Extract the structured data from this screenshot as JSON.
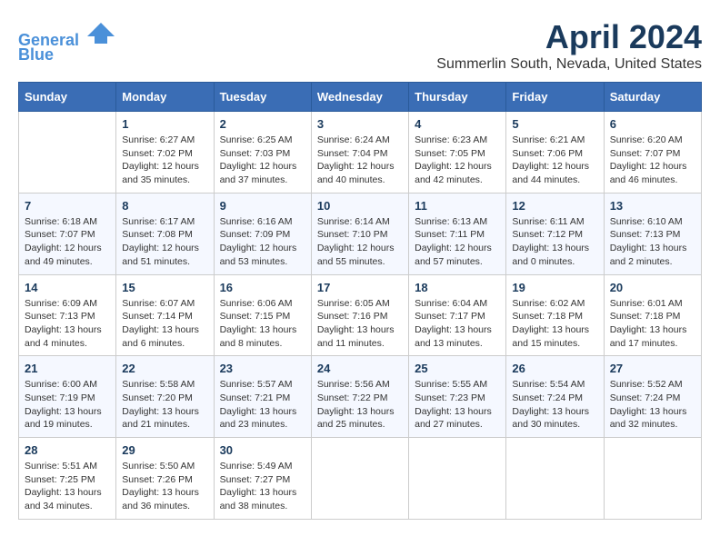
{
  "header": {
    "logo_line1": "General",
    "logo_line2": "Blue",
    "month_title": "April 2024",
    "location": "Summerlin South, Nevada, United States"
  },
  "weekdays": [
    "Sunday",
    "Monday",
    "Tuesday",
    "Wednesday",
    "Thursday",
    "Friday",
    "Saturday"
  ],
  "weeks": [
    [
      {
        "day": "",
        "info": ""
      },
      {
        "day": "1",
        "info": "Sunrise: 6:27 AM\nSunset: 7:02 PM\nDaylight: 12 hours\nand 35 minutes."
      },
      {
        "day": "2",
        "info": "Sunrise: 6:25 AM\nSunset: 7:03 PM\nDaylight: 12 hours\nand 37 minutes."
      },
      {
        "day": "3",
        "info": "Sunrise: 6:24 AM\nSunset: 7:04 PM\nDaylight: 12 hours\nand 40 minutes."
      },
      {
        "day": "4",
        "info": "Sunrise: 6:23 AM\nSunset: 7:05 PM\nDaylight: 12 hours\nand 42 minutes."
      },
      {
        "day": "5",
        "info": "Sunrise: 6:21 AM\nSunset: 7:06 PM\nDaylight: 12 hours\nand 44 minutes."
      },
      {
        "day": "6",
        "info": "Sunrise: 6:20 AM\nSunset: 7:07 PM\nDaylight: 12 hours\nand 46 minutes."
      }
    ],
    [
      {
        "day": "7",
        "info": "Sunrise: 6:18 AM\nSunset: 7:07 PM\nDaylight: 12 hours\nand 49 minutes."
      },
      {
        "day": "8",
        "info": "Sunrise: 6:17 AM\nSunset: 7:08 PM\nDaylight: 12 hours\nand 51 minutes."
      },
      {
        "day": "9",
        "info": "Sunrise: 6:16 AM\nSunset: 7:09 PM\nDaylight: 12 hours\nand 53 minutes."
      },
      {
        "day": "10",
        "info": "Sunrise: 6:14 AM\nSunset: 7:10 PM\nDaylight: 12 hours\nand 55 minutes."
      },
      {
        "day": "11",
        "info": "Sunrise: 6:13 AM\nSunset: 7:11 PM\nDaylight: 12 hours\nand 57 minutes."
      },
      {
        "day": "12",
        "info": "Sunrise: 6:11 AM\nSunset: 7:12 PM\nDaylight: 13 hours\nand 0 minutes."
      },
      {
        "day": "13",
        "info": "Sunrise: 6:10 AM\nSunset: 7:13 PM\nDaylight: 13 hours\nand 2 minutes."
      }
    ],
    [
      {
        "day": "14",
        "info": "Sunrise: 6:09 AM\nSunset: 7:13 PM\nDaylight: 13 hours\nand 4 minutes."
      },
      {
        "day": "15",
        "info": "Sunrise: 6:07 AM\nSunset: 7:14 PM\nDaylight: 13 hours\nand 6 minutes."
      },
      {
        "day": "16",
        "info": "Sunrise: 6:06 AM\nSunset: 7:15 PM\nDaylight: 13 hours\nand 8 minutes."
      },
      {
        "day": "17",
        "info": "Sunrise: 6:05 AM\nSunset: 7:16 PM\nDaylight: 13 hours\nand 11 minutes."
      },
      {
        "day": "18",
        "info": "Sunrise: 6:04 AM\nSunset: 7:17 PM\nDaylight: 13 hours\nand 13 minutes."
      },
      {
        "day": "19",
        "info": "Sunrise: 6:02 AM\nSunset: 7:18 PM\nDaylight: 13 hours\nand 15 minutes."
      },
      {
        "day": "20",
        "info": "Sunrise: 6:01 AM\nSunset: 7:18 PM\nDaylight: 13 hours\nand 17 minutes."
      }
    ],
    [
      {
        "day": "21",
        "info": "Sunrise: 6:00 AM\nSunset: 7:19 PM\nDaylight: 13 hours\nand 19 minutes."
      },
      {
        "day": "22",
        "info": "Sunrise: 5:58 AM\nSunset: 7:20 PM\nDaylight: 13 hours\nand 21 minutes."
      },
      {
        "day": "23",
        "info": "Sunrise: 5:57 AM\nSunset: 7:21 PM\nDaylight: 13 hours\nand 23 minutes."
      },
      {
        "day": "24",
        "info": "Sunrise: 5:56 AM\nSunset: 7:22 PM\nDaylight: 13 hours\nand 25 minutes."
      },
      {
        "day": "25",
        "info": "Sunrise: 5:55 AM\nSunset: 7:23 PM\nDaylight: 13 hours\nand 27 minutes."
      },
      {
        "day": "26",
        "info": "Sunrise: 5:54 AM\nSunset: 7:24 PM\nDaylight: 13 hours\nand 30 minutes."
      },
      {
        "day": "27",
        "info": "Sunrise: 5:52 AM\nSunset: 7:24 PM\nDaylight: 13 hours\nand 32 minutes."
      }
    ],
    [
      {
        "day": "28",
        "info": "Sunrise: 5:51 AM\nSunset: 7:25 PM\nDaylight: 13 hours\nand 34 minutes."
      },
      {
        "day": "29",
        "info": "Sunrise: 5:50 AM\nSunset: 7:26 PM\nDaylight: 13 hours\nand 36 minutes."
      },
      {
        "day": "30",
        "info": "Sunrise: 5:49 AM\nSunset: 7:27 PM\nDaylight: 13 hours\nand 38 minutes."
      },
      {
        "day": "",
        "info": ""
      },
      {
        "day": "",
        "info": ""
      },
      {
        "day": "",
        "info": ""
      },
      {
        "day": "",
        "info": ""
      }
    ]
  ]
}
